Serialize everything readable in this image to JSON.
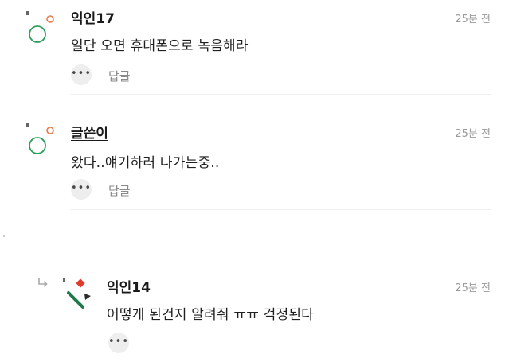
{
  "comments": [
    {
      "username": "익인17",
      "time": "25분 전",
      "text": "일단 오면 휴대폰으로 녹음해라",
      "reply_label": "답글",
      "avatar": "circle-avatar-icon"
    },
    {
      "username": "글쓴이",
      "time": "25분 전",
      "text": "왔다..얘기하러 나가는중..",
      "reply_label": "답글",
      "avatar": "circle-avatar-icon"
    },
    {
      "username": "익인14",
      "time": "25분 전",
      "text": "어떻게 된건지 알려줘 ㅠㅠ 걱정된다",
      "avatar": "shapes-avatar-icon"
    }
  ],
  "more_glyph": "•••",
  "colors": {
    "avatar_ring": "#2f9e5a",
    "avatar_dot": "#e8794a",
    "diamond_red": "#e03a2e",
    "line_green": "#1f7a4a",
    "triangle_dark": "#2a2a2a"
  }
}
